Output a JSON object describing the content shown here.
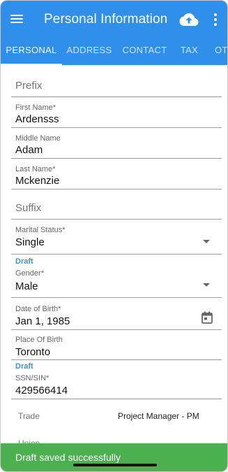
{
  "header": {
    "title": "Personal Information",
    "icons": {
      "menu": "menu-icon",
      "upload": "cloud-upload-icon",
      "more": "more-vert-icon"
    }
  },
  "tabs": [
    {
      "label": "PERSONAL",
      "active": true
    },
    {
      "label": "ADDRESS",
      "active": false
    },
    {
      "label": "CONTACT",
      "active": false
    },
    {
      "label": "TAX",
      "active": false
    },
    {
      "label": "OTI",
      "active": false
    }
  ],
  "form": {
    "prefix": {
      "placeholder": "Prefix"
    },
    "first_name": {
      "label": "First Name*",
      "value": "Ardensss"
    },
    "middle_name": {
      "label": "Middle Name",
      "value": "Adam"
    },
    "last_name": {
      "label": "Last Name*",
      "value": "Mckenzie"
    },
    "suffix": {
      "placeholder": "Suffix"
    },
    "marital_status": {
      "label": "Marital Status*",
      "value": "Single"
    },
    "gender": {
      "badge": "Draft",
      "label": "Gender*",
      "value": "Male"
    },
    "date_of_birth": {
      "label": "Date of Birth*",
      "value": "Jan 1, 1985"
    },
    "place_of_birth": {
      "label": "Place Of Birth",
      "value": "Toronto"
    },
    "ssn": {
      "badge": "Draft",
      "label": "SSN/SIN*",
      "value": "429566414"
    },
    "trade": {
      "label": "Trade",
      "value": "Project Manager - PM"
    },
    "union": {
      "label": "Union"
    }
  },
  "snackbar": {
    "message": "Draft saved successfully"
  },
  "colors": {
    "primary": "#2f8fea",
    "snackbar": "#4caf50",
    "draft": "#3a92d8"
  }
}
